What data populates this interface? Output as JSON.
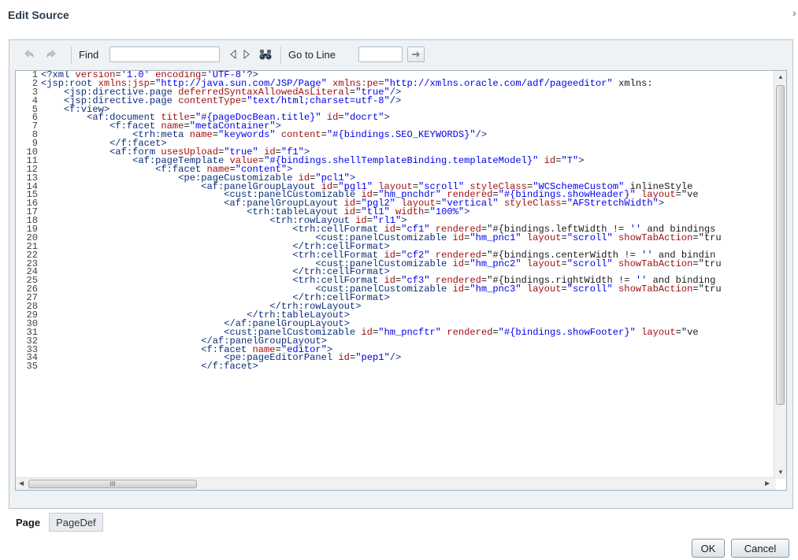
{
  "dialog": {
    "title": "Edit Source"
  },
  "toolbar": {
    "find_label": "Find",
    "find_value": "",
    "goto_label": "Go to Line",
    "goto_value": ""
  },
  "editor": {
    "lines": [
      {
        "n": "1",
        "t": "<?xml version='1.0' encoding='UTF-8'?>"
      },
      {
        "n": "2",
        "t": "<jsp:root xmlns:jsp=\"http://java.sun.com/JSP/Page\" xmlns:pe=\"http://xmlns.oracle.com/adf/pageeditor\" xmlns:"
      },
      {
        "n": "3",
        "t": "    <jsp:directive.page deferredSyntaxAllowedAsLiteral=\"true\"/>"
      },
      {
        "n": "4",
        "t": "    <jsp:directive.page contentType=\"text/html;charset=utf-8\"/>"
      },
      {
        "n": "5",
        "t": "    <f:view>"
      },
      {
        "n": "6",
        "t": "        <af:document title=\"#{pageDocBean.title}\" id=\"docrt\">"
      },
      {
        "n": "7",
        "t": "            <f:facet name=\"metaContainer\">"
      },
      {
        "n": "8",
        "t": "                <trh:meta name=\"keywords\" content=\"#{bindings.SEO_KEYWORDS}\"/>"
      },
      {
        "n": "9",
        "t": "            </f:facet>"
      },
      {
        "n": "10",
        "t": "            <af:form usesUpload=\"true\" id=\"f1\">"
      },
      {
        "n": "11",
        "t": "                <af:pageTemplate value=\"#{bindings.shellTemplateBinding.templateModel}\" id=\"T\">"
      },
      {
        "n": "12",
        "t": "                    <f:facet name=\"content\">"
      },
      {
        "n": "13",
        "t": "                        <pe:pageCustomizable id=\"pcl1\">"
      },
      {
        "n": "14",
        "t": "                            <af:panelGroupLayout id=\"pgl1\" layout=\"scroll\" styleClass=\"WCSchemeCustom\" inlineStyle"
      },
      {
        "n": "15",
        "t": "                                <cust:panelCustomizable id=\"hm_pnchdr\" rendered=\"#{bindings.showHeader}\" layout=\"ve"
      },
      {
        "n": "16",
        "t": "                                <af:panelGroupLayout id=\"pgl2\" layout=\"vertical\" styleClass=\"AFStretchWidth\">"
      },
      {
        "n": "17",
        "t": "                                    <trh:tableLayout id=\"tl1\" width=\"100%\">"
      },
      {
        "n": "18",
        "t": "                                        <trh:rowLayout id=\"rl1\">"
      },
      {
        "n": "19",
        "t": "                                            <trh:cellFormat id=\"cf1\" rendered=\"#{bindings.leftWidth != '' and bindings"
      },
      {
        "n": "20",
        "t": "                                                <cust:panelCustomizable id=\"hm_pnc1\" layout=\"scroll\" showTabAction=\"tru"
      },
      {
        "n": "21",
        "t": "                                            </trh:cellFormat>"
      },
      {
        "n": "22",
        "t": "                                            <trh:cellFormat id=\"cf2\" rendered=\"#{bindings.centerWidth != '' and bindin"
      },
      {
        "n": "23",
        "t": "                                                <cust:panelCustomizable id=\"hm_pnc2\" layout=\"scroll\" showTabAction=\"tru"
      },
      {
        "n": "24",
        "t": "                                            </trh:cellFormat>"
      },
      {
        "n": "25",
        "t": "                                            <trh:cellFormat id=\"cf3\" rendered=\"#{bindings.rightWidth != '' and binding"
      },
      {
        "n": "26",
        "t": "                                                <cust:panelCustomizable id=\"hm_pnc3\" layout=\"scroll\" showTabAction=\"tru"
      },
      {
        "n": "27",
        "t": "                                            </trh:cellFormat>"
      },
      {
        "n": "28",
        "t": "                                        </trh:rowLayout>"
      },
      {
        "n": "29",
        "t": "                                    </trh:tableLayout>"
      },
      {
        "n": "30",
        "t": "                                </af:panelGroupLayout>"
      },
      {
        "n": "31",
        "t": "                                <cust:panelCustomizable id=\"hm_pncftr\" rendered=\"#{bindings.showFooter}\" layout=\"ve"
      },
      {
        "n": "32",
        "t": "                            </af:panelGroupLayout>"
      },
      {
        "n": "33",
        "t": "                            <f:facet name=\"editor\">"
      },
      {
        "n": "34",
        "t": "                                <pe:pageEditorPanel id=\"pep1\"/>"
      },
      {
        "n": "35",
        "t": "                            </f:facet>"
      }
    ]
  },
  "scrollbar": {
    "h_thumb_label": "III"
  },
  "tabs": [
    {
      "label": "Page",
      "active": true
    },
    {
      "label": "PageDef",
      "active": false
    }
  ],
  "buttons": {
    "ok": "OK",
    "cancel": "Cancel"
  },
  "colors": {
    "title": "#2a3b4d",
    "panel_bg": "#eef2f5",
    "tag": "#0a2e7a",
    "attr": "#a01010",
    "string": "#0000ee"
  }
}
